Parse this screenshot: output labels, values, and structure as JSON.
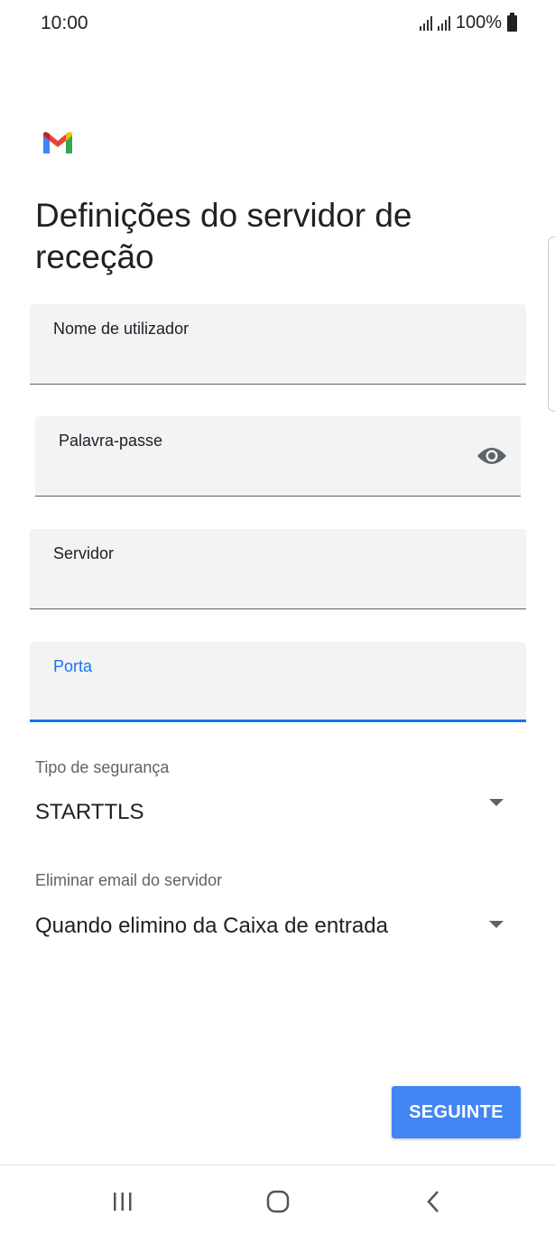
{
  "status_bar": {
    "time": "10:00",
    "battery": "100%"
  },
  "app": {
    "logo": "gmail-logo"
  },
  "page": {
    "title": "Definições do servidor de receção"
  },
  "fields": {
    "username": {
      "label": "Nome de utilizador",
      "value": ""
    },
    "password": {
      "label": "Palavra-passe",
      "value": "",
      "icon": "eye-icon"
    },
    "server": {
      "label": "Servidor",
      "value": ""
    },
    "port": {
      "label": "Porta",
      "value": "",
      "focused": true
    }
  },
  "security": {
    "label": "Tipo de segurança",
    "value": "STARTTLS"
  },
  "delete_email": {
    "label": "Eliminar email do servidor",
    "value": "Quando elimino da Caixa de entrada"
  },
  "actions": {
    "next_label": "SEGUINTE"
  },
  "colors": {
    "accent": "#1a73e8",
    "button": "#4285f4",
    "field_bg": "#f1f3f4"
  },
  "nav": {
    "items": [
      "recents-icon",
      "home-icon",
      "back-icon"
    ]
  }
}
